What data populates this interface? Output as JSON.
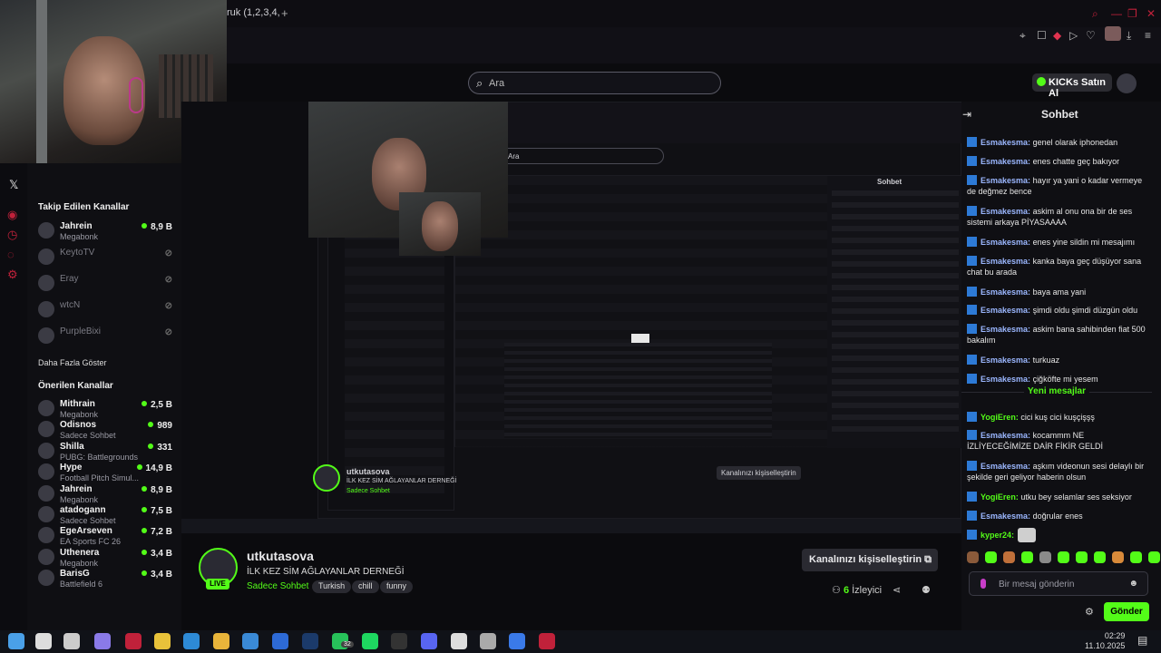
{
  "browser": {
    "tab_title": "ruk (1,2,3,4,",
    "new_tab_icon": "plus-icon"
  },
  "header": {
    "search_placeholder": "Ara",
    "kicks_button": "KICKs Satın Al"
  },
  "sidebar": {
    "followed_title": "Takip Edilen Kanallar",
    "show_more": "Daha Fazla Göster",
    "recommended_title": "Önerilen Kanallar",
    "followed": [
      {
        "name": "Jahrein",
        "category": "Megabonk",
        "viewers": "8,9 B",
        "live": true
      },
      {
        "name": "KeytoTV",
        "category": "",
        "viewers": "",
        "live": false
      },
      {
        "name": "Eray",
        "category": "",
        "viewers": "",
        "live": false
      },
      {
        "name": "wtcN",
        "category": "",
        "viewers": "",
        "live": false
      },
      {
        "name": "PurpleBixi",
        "category": "",
        "viewers": "",
        "live": false
      }
    ],
    "recommended": [
      {
        "name": "Mithrain",
        "category": "Megabonk",
        "viewers": "2,5 B"
      },
      {
        "name": "Odisnos",
        "category": "Sadece Sohbet",
        "viewers": "989"
      },
      {
        "name": "Shilla",
        "category": "PUBG: Battlegrounds",
        "viewers": "331"
      },
      {
        "name": "Hype",
        "category": "Football Pitch Simul...",
        "viewers": "14,9 B"
      },
      {
        "name": "Jahrein",
        "category": "Megabonk",
        "viewers": "8,9 B"
      },
      {
        "name": "atadogann",
        "category": "Sadece Sohbet",
        "viewers": "7,5 B"
      },
      {
        "name": "EgeArseven",
        "category": "EA Sports FC 26",
        "viewers": "7,2 B"
      },
      {
        "name": "Uthenera",
        "category": "Megabonk",
        "viewers": "3,4 B"
      },
      {
        "name": "BarisG",
        "category": "Battlefield 6",
        "viewers": "3,4 B"
      }
    ]
  },
  "stream": {
    "channel": "utkutasova",
    "live": "LIVE",
    "title": "İLK KEZ SİM AĞLAYANLAR DERNEĞİ",
    "category": "Sadece Sohbet",
    "tags": [
      "Turkish",
      "chill",
      "funny"
    ],
    "customize": "Kanalınızı kişiselleştirin",
    "viewers_count": "6",
    "viewers_label": "İzleyici"
  },
  "chat": {
    "title": "Sohbet",
    "new_messages": "Yeni mesajlar",
    "messages": [
      {
        "user": "Esmakesma",
        "text": "genel olarak iphonedan"
      },
      {
        "user": "Esmakesma",
        "text": "enes chatte geç bakıyor"
      },
      {
        "user": "Esmakesma",
        "text": "hayır ya yani o kadar vermeye de değmez bence"
      },
      {
        "user": "Esmakesma",
        "text": "askim al onu ona bir de ses sistemi arkaya PİYASAAAA"
      },
      {
        "user": "Esmakesma",
        "text": "enes yine sildin mi mesajımı"
      },
      {
        "user": "Esmakesma",
        "text": "kanka baya geç düşüyor sana chat bu arada"
      },
      {
        "user": "Esmakesma",
        "text": "baya ama yani"
      },
      {
        "user": "Esmakesma",
        "text": "şimdi oldu şimdi düzgün oldu"
      },
      {
        "user": "Esmakesma",
        "text": "askim bana sahibinden fiat 500 bakalım"
      },
      {
        "user": "Esmakesma",
        "text": "turkuaz"
      },
      {
        "user": "Esmakesma",
        "text": "çiğköfte mi yesem"
      }
    ],
    "new": [
      {
        "user": "YogiEren",
        "text": "cici kuş cici kuşçişşş",
        "green": true
      },
      {
        "user": "Esmakesma",
        "text": "kocammm NE İZLİYECEĞİMİZE DAİR FİKİR GELDİ"
      },
      {
        "user": "Esmakesma",
        "text": "aşkım videonun sesi delaylı bir şekilde geri geliyor haberin olsun"
      },
      {
        "user": "YogiEren",
        "text": "utku bey selamlar ses seksiyor",
        "green": true
      },
      {
        "user": "Esmakesma",
        "text": "doğrular enes"
      },
      {
        "user": "kyper24",
        "text": "",
        "green": true
      }
    ],
    "input_placeholder": "Bir mesaj gönderin",
    "send": "Gönder"
  },
  "taskbar": {
    "time": "02:29",
    "date": "11.10.2025",
    "badge": "32"
  },
  "colors": {
    "accent": "#53fc18",
    "background": "#0b0b0e"
  }
}
